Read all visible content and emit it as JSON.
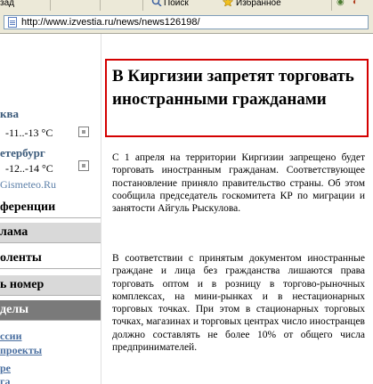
{
  "toolbar": {
    "back_label": "зад",
    "search_label": "Поиск",
    "favorites_label": "Избранное"
  },
  "address": {
    "url": "http://www.izvestia.ru/news/news126198/"
  },
  "sidebar": {
    "weather": [
      {
        "city": "ква",
        "temp": "-11..-13 °С"
      },
      {
        "city": "етербург",
        "temp": "-12..-14 °С"
      }
    ],
    "source": "Gismeteo.Ru",
    "menu": [
      {
        "label": "ференции"
      },
      {
        "label": "лама"
      },
      {
        "label": "оленты"
      },
      {
        "label": "ь номер"
      },
      {
        "label": "делы"
      }
    ],
    "links": [
      "ссии",
      "проекты",
      "ре",
      "га"
    ]
  },
  "article": {
    "title": "В Киргизии запретят торговать иностранными гражданами",
    "paragraphs": [
      "С 1 апреля на территории Киргизии запрещено будет торговать иностранным гражданам. Соответствующее постановление приняло правительство страны. Об этом сообщила председатель госкомитета КР по миграции и занятости Айгуль Рыскулова.",
      "В соответствии с принятым документом иностранные граждане и лица без гражданства лишаются права торговать оптом и в розницу в торгово-рыночных комплексах, на мини-рынках и в нестационарных торговых точках. При этом в стационарных торговых точках, магазинах и торговых центрах число иностранцев должно составлять не более 10% от общего числа предпринимателей."
    ]
  }
}
